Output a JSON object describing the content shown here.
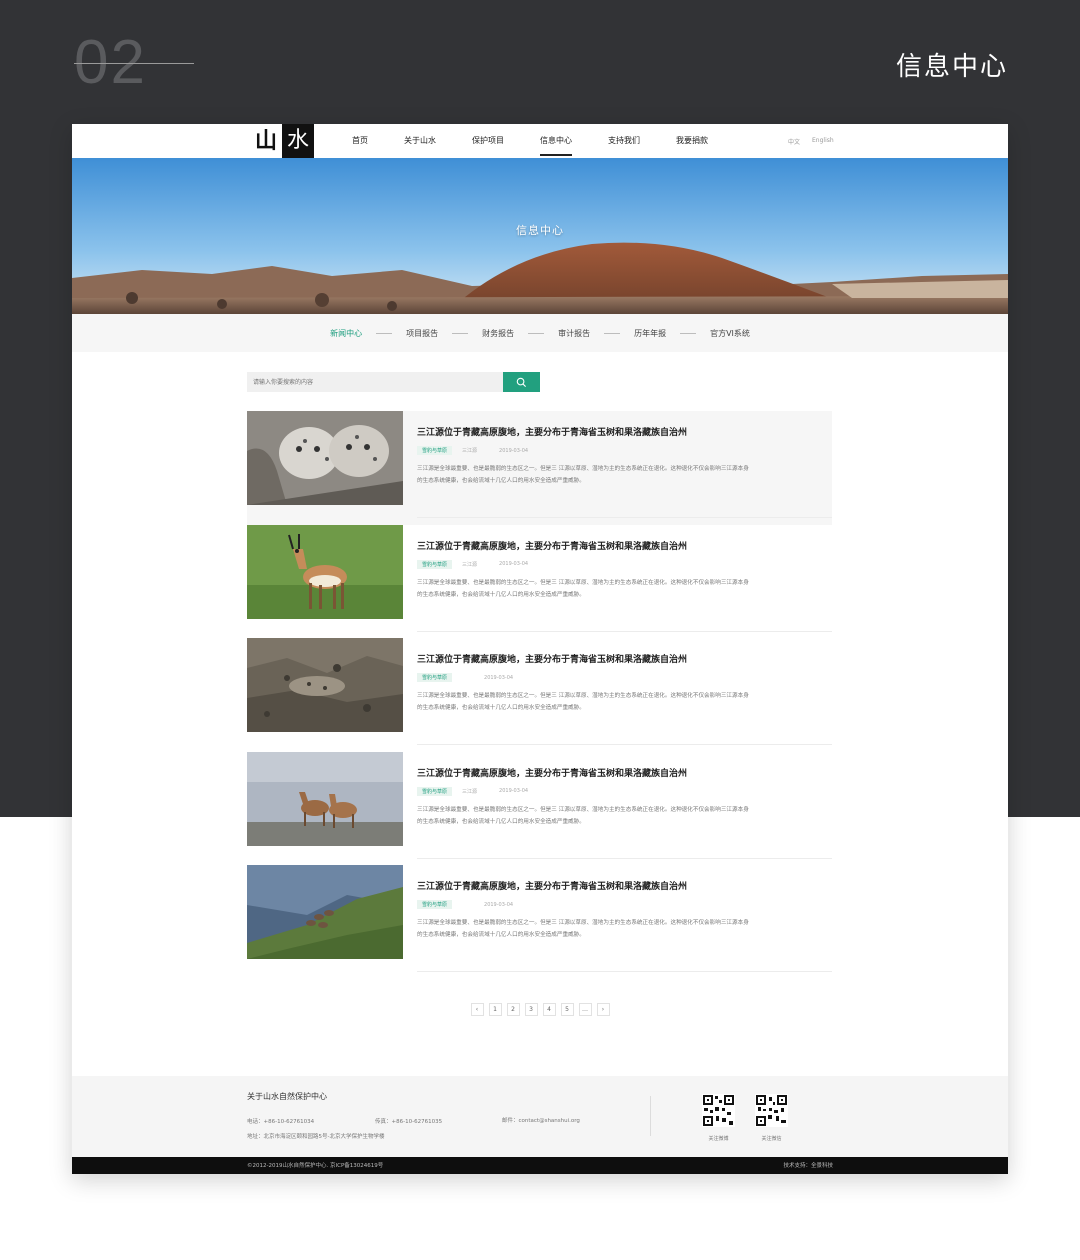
{
  "header": {
    "section_number": "02",
    "section_title": "信息中心"
  },
  "nav": {
    "logo_left": "山",
    "logo_right": "水",
    "items": [
      {
        "label": "首页"
      },
      {
        "label": "关于山水"
      },
      {
        "label": "保护项目"
      },
      {
        "label": "信息中心",
        "active": true
      },
      {
        "label": "支持我们"
      },
      {
        "label": "我要捐款"
      }
    ],
    "lang_cn": "中文",
    "lang_en": "English"
  },
  "banner": {
    "title": "信息中心"
  },
  "subnav": {
    "items": [
      "新闻中心",
      "项目报告",
      "财务报告",
      "审计报告",
      "历年年报",
      "官方VI系统"
    ],
    "active_index": 0
  },
  "search": {
    "placeholder": "请输入你要搜索的内容",
    "button_icon": "search-icon"
  },
  "articles": [
    {
      "title": "三江源位于青藏高原腹地，主要分布于青海省玉树和果洛藏族自治州",
      "tag": "雪豹与草原",
      "tag2": "三江源",
      "date": "2019-03-04",
      "excerpt_line1": "三江源是全球最重要、也是最脆弱的生态区之一。但是三 江源以草原、湿地为主的生态系统正在退化。这种退化不仅会影响三江源本身",
      "excerpt_line2": "的生态系统健康，也会给流域十几亿人口的用水安全造成严重威胁。",
      "thumb": "snow-leopard-cubs"
    },
    {
      "title": "三江源位于青藏高原腹地，主要分布于青海省玉树和果洛藏族自治州",
      "tag": "雪豹与草原",
      "tag2": "三江源",
      "date": "2019-03-04",
      "excerpt_line1": "三江源是全球最重要、也是最脆弱的生态区之一。但是三 江源以草原、湿地为主的生态系统正在退化。这种退化不仅会影响三江源本身",
      "excerpt_line2": "的生态系统健康，也会给流域十几亿人口的用水安全造成严重威胁。",
      "thumb": "antelope"
    },
    {
      "title": "三江源位于青藏高原腹地，主要分布于青海省玉树和果洛藏族自治州",
      "tag": "雪豹与草原",
      "tag2": "",
      "date": "2019-03-04",
      "excerpt_line1": "三江源是全球最重要、也是最脆弱的生态区之一。但是三 江源以草原、湿地为主的生态系统正在退化。这种退化不仅会影响三江源本身",
      "excerpt_line2": "的生态系统健康，也会给流域十几亿人口的用水安全造成严重威胁。",
      "thumb": "snow-leopard-rocks"
    },
    {
      "title": "三江源位于青藏高原腹地，主要分布于青海省玉树和果洛藏族自治州",
      "tag": "雪豹与草原",
      "tag2": "三江源",
      "date": "2019-03-04",
      "excerpt_line1": "三江源是全球最重要、也是最脆弱的生态区之一。但是三 江源以草原、湿地为主的生态系统正在退化。这种退化不仅会影响三江源本身",
      "excerpt_line2": "的生态系统健康，也会给流域十几亿人口的用水安全造成严重威胁。",
      "thumb": "wild-asses"
    },
    {
      "title": "三江源位于青藏高原腹地，主要分布于青海省玉树和果洛藏族自治州",
      "tag": "雪豹与草原",
      "tag2": "",
      "date": "2019-03-04",
      "excerpt_line1": "三江源是全球最重要、也是最脆弱的生态区之一。但是三 江源以草原、湿地为主的生态系统正在退化。这种退化不仅会影响三江源本身",
      "excerpt_line2": "的生态系统健康，也会给流域十几亿人口的用水安全造成严重威胁。",
      "thumb": "deer-hillside"
    }
  ],
  "pagination": {
    "prev": "‹",
    "pages": [
      "1",
      "2",
      "3",
      "4",
      "5",
      "…"
    ],
    "next": "›"
  },
  "footer": {
    "title": "关于山水自然保护中心",
    "phone": "电话：+86-10-62761034",
    "fax": "传真：+86-10-62761035",
    "email": "邮件：contact@shanshui.org",
    "address": "地址：北京市海淀区颐和园路5号-北京大学保护生物学楼",
    "qr1_caption": "关注微博",
    "qr2_caption": "关注微信",
    "copyright": "©2012-2019山水自然保护中心. 京ICP备13024619号",
    "tech_support": "技术支持：全景科技"
  },
  "colors": {
    "dark_bg": "#323336",
    "accent_green": "#1a9c7d",
    "search_button": "#22a07f",
    "bottom_bar": "#0e0e0e"
  }
}
